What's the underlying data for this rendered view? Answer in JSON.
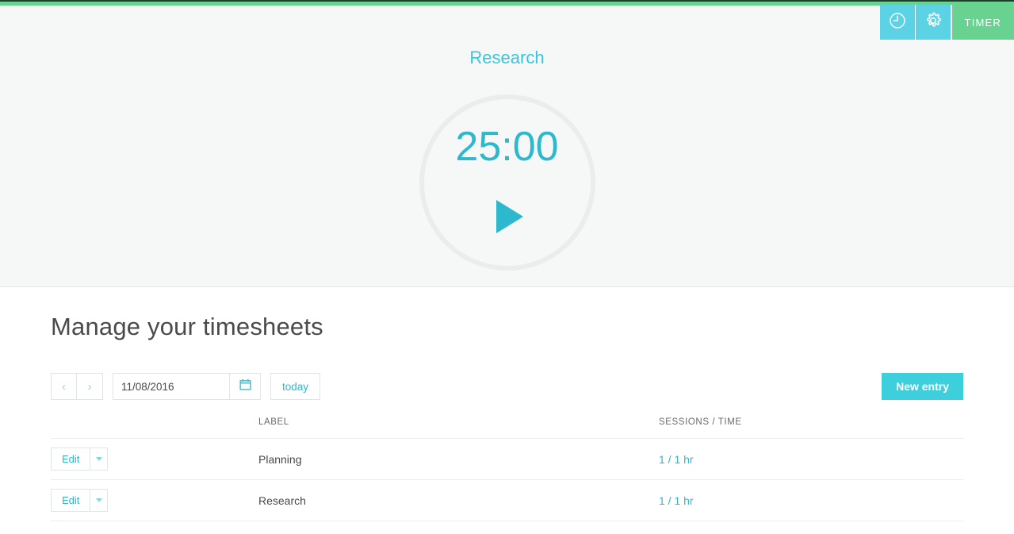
{
  "topbar": {
    "accent_dark": "#1f3d2b",
    "accent_green": "#68d391",
    "nav": {
      "clock_icon": "clock-icon",
      "gear_icon": "gear-icon",
      "timer_label": "TIMER"
    }
  },
  "timer": {
    "project_name": "Research",
    "time_display": "25:00",
    "play_icon": "play-icon",
    "accent_color": "#2cb8cd",
    "ring_color": "#ececec"
  },
  "page": {
    "title": "Manage your timesheets"
  },
  "toolbar": {
    "prev_label": "‹",
    "next_label": "›",
    "date_value": "11/08/2016",
    "date_placeholder": "mm/dd/yyyy",
    "calendar_icon": "calendar-icon",
    "today_label": "today",
    "new_entry_label": "New entry",
    "new_entry_color": "#3ecfdd"
  },
  "table": {
    "columns": [
      "",
      "LABEL",
      "SESSIONS / TIME"
    ],
    "rows": [
      {
        "edit_label": "Edit",
        "caret_icon": "chevron-down-icon",
        "label": "Planning",
        "sessions_time": "1 / 1 hr"
      },
      {
        "edit_label": "Edit",
        "caret_icon": "chevron-down-icon",
        "label": "Research",
        "sessions_time": "1 / 1 hr"
      }
    ]
  }
}
